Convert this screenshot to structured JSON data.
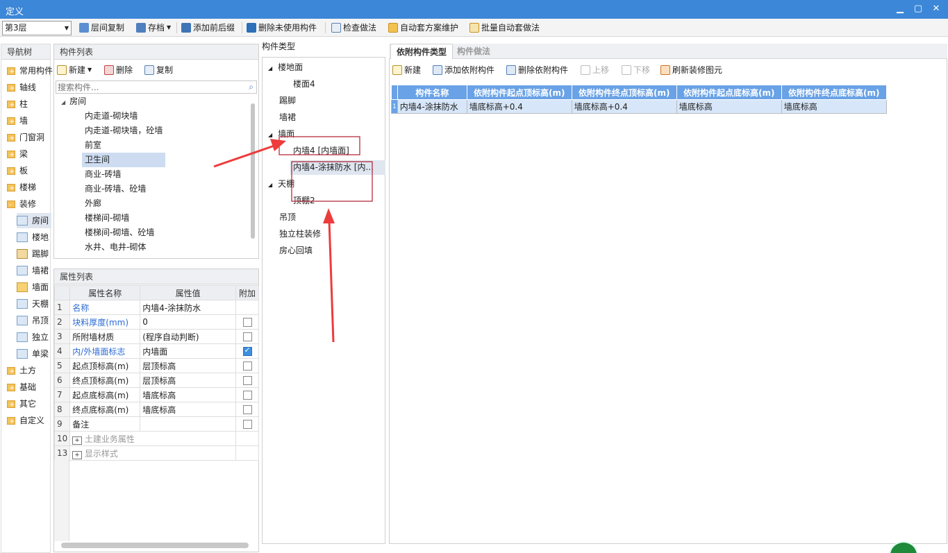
{
  "window": {
    "title": "定义",
    "min": "▁",
    "max": "▢",
    "close": "✕"
  },
  "toolbar": {
    "floor": "第3层",
    "items": [
      "层间复制",
      "存档",
      "添加前后缀",
      "删除未使用构件",
      "检查做法",
      "自动套方案维护",
      "批量自动套做法"
    ]
  },
  "nav": {
    "title": "导航树",
    "items": [
      "常用构件",
      "轴线",
      "柱",
      "墙",
      "门窗洞",
      "梁",
      "板",
      "楼梯",
      "装修"
    ],
    "sub": [
      "房间",
      "楼地",
      "踢脚",
      "墙裙",
      "墙面",
      "天棚",
      "吊顶",
      "独立",
      "单梁"
    ],
    "items2": [
      "土方",
      "基础",
      "其它",
      "自定义"
    ]
  },
  "components": {
    "title": "构件列表",
    "new": "新建",
    "delete": "删除",
    "copy": "复制",
    "search_placeholder": "搜索构件...",
    "root": "房间",
    "items": [
      "内走道-砌块墙",
      "内走道-砌块墙，砼墙",
      "前室",
      "卫生间",
      "商业-砖墙",
      "商业-砖墙、砼墙",
      "外廊",
      "楼梯间-砌墙",
      "楼梯间-砌墙、砼墙",
      "水井、电井-砌体"
    ]
  },
  "props": {
    "title": "属性列表",
    "col_name": "属性名称",
    "col_value": "属性值",
    "col_extra": "附加",
    "rows": [
      {
        "n": "1",
        "name": "名称",
        "value": "内墙4-涂抹防水"
      },
      {
        "n": "2",
        "name": "块料厚度(mm)",
        "value": "0"
      },
      {
        "n": "3",
        "name": "所附墙材质",
        "value": "(程序自动判断)"
      },
      {
        "n": "4",
        "name": "内/外墙面标志",
        "value": "内墙面"
      },
      {
        "n": "5",
        "name": "起点顶标高(m)",
        "value": "层顶标高"
      },
      {
        "n": "6",
        "name": "终点顶标高(m)",
        "value": "层顶标高"
      },
      {
        "n": "7",
        "name": "起点底标高(m)",
        "value": "墙底标高"
      },
      {
        "n": "8",
        "name": "终点底标高(m)",
        "value": "墙底标高"
      },
      {
        "n": "9",
        "name": "备注",
        "value": ""
      },
      {
        "n": "10",
        "name": "土建业务属性",
        "value": ""
      },
      {
        "n": "13",
        "name": "显示样式",
        "value": ""
      }
    ]
  },
  "types": {
    "title": "构件类型",
    "floor": "楼地面",
    "floor4": "楼面4",
    "skirting": "踢脚",
    "dado": "墙裙",
    "wall": "墙面",
    "wall1": "内墙4 [内墙面]",
    "wall2": "内墙4-涂抹防水 [内...",
    "ceiling": "天棚",
    "ceiling2": "顶棚2",
    "suspended": "吊顶",
    "column": "独立柱装修",
    "backfill": "房心回填"
  },
  "attached": {
    "tab1": "依附构件类型",
    "tab2": "构件做法",
    "toolbar": [
      "新建",
      "添加依附构件",
      "删除依附构件",
      "上移",
      "下移",
      "刷新装修图元"
    ],
    "headers": [
      "构件名称",
      "依附构件起点顶标高(m)",
      "依附构件终点顶标高(m)",
      "依附构件起点底标高(m)",
      "依附构件终点底标高(m)"
    ],
    "row_num": "1",
    "row": [
      "内墙4-涂抹防水",
      "墙底标高+0.4",
      "墙底标高+0.4",
      "墙底标高",
      "墙底标高"
    ]
  }
}
